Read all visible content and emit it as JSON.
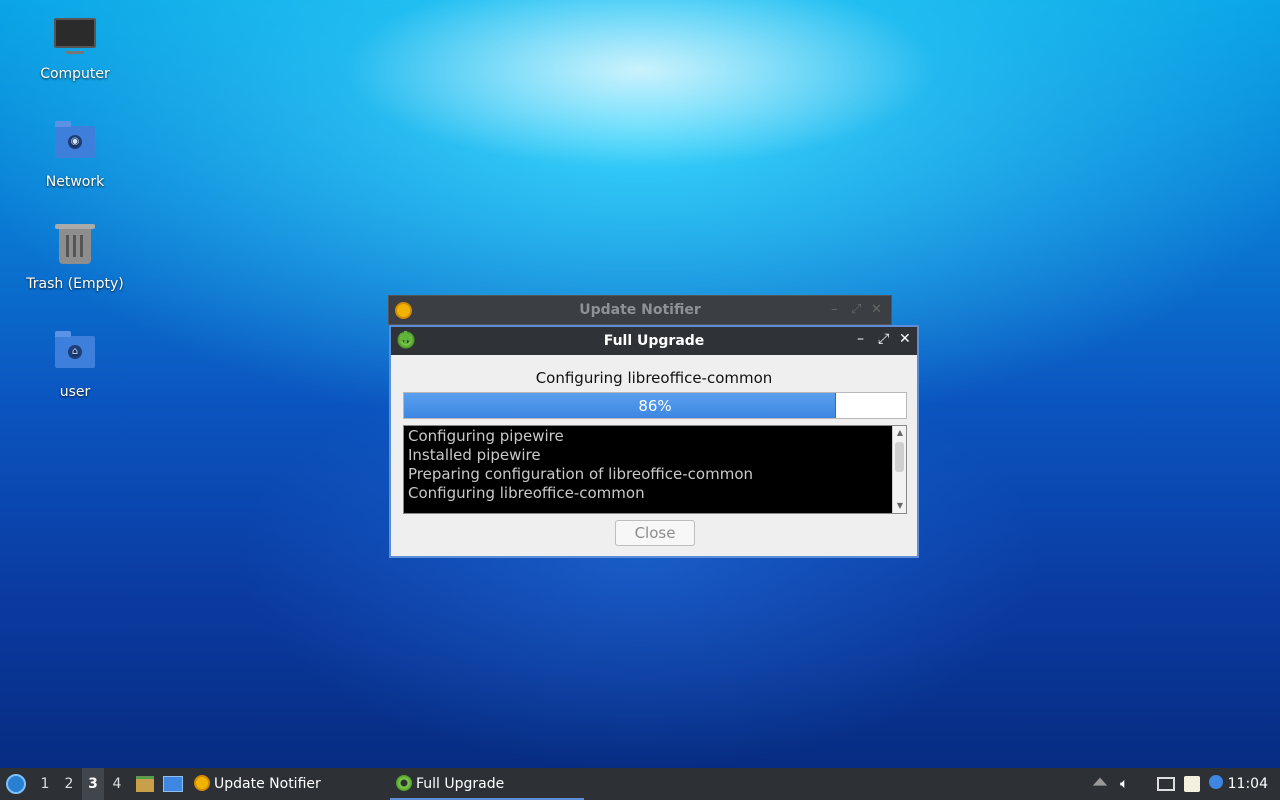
{
  "desktop": {
    "icons": [
      {
        "label": "Computer"
      },
      {
        "label": "Network"
      },
      {
        "label": "Trash (Empty)"
      },
      {
        "label": "user"
      }
    ]
  },
  "background_window": {
    "title": "Update Notifier",
    "icon": "update-notifier-icon"
  },
  "dialog": {
    "title": "Full Upgrade",
    "icon": "gear-icon",
    "controls": {
      "minimize": "–",
      "maximize": "⤢",
      "close": "✕"
    },
    "status": "Configuring libreoffice-common",
    "progress": {
      "value": 0.86,
      "label": "86%"
    },
    "log_lines": [
      "Configuring pipewire",
      "Installed pipewire",
      "Preparing configuration of libreoffice-common",
      "Configuring libreoffice-common"
    ],
    "close_label": "Close"
  },
  "taskbar": {
    "workspaces": [
      "1",
      "2",
      "3",
      "4"
    ],
    "active_workspace": "3",
    "tasks": [
      {
        "label": "Update Notifier",
        "icon": "update-notifier-icon"
      },
      {
        "label": "Full Upgrade",
        "icon": "gear-icon"
      }
    ],
    "clock": "11:04"
  },
  "colors": {
    "accent": "#5b8ed6",
    "progress_fill": "#3d86e2",
    "taskbar": "#2d3136"
  }
}
